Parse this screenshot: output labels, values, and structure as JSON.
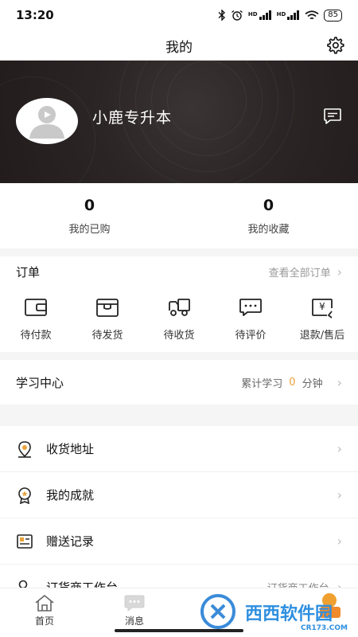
{
  "status": {
    "time": "13:20",
    "battery": "85",
    "hd1": "HD",
    "hd2": "HD"
  },
  "header": {
    "title": "我的"
  },
  "profile": {
    "name": "小鹿专升本"
  },
  "stats": [
    {
      "value": "0",
      "label": "我的已购"
    },
    {
      "value": "0",
      "label": "我的收藏"
    }
  ],
  "orders": {
    "title": "订单",
    "view_all": "查看全部订单",
    "items": [
      {
        "label": "待付款",
        "icon": "wallet-icon"
      },
      {
        "label": "待发货",
        "icon": "box-icon"
      },
      {
        "label": "待收货",
        "icon": "truck-icon"
      },
      {
        "label": "待评价",
        "icon": "comment-icon"
      },
      {
        "label": "退款/售后",
        "icon": "refund-icon"
      }
    ]
  },
  "study": {
    "title": "学习中心",
    "prefix": "累计学习",
    "minutes": "0",
    "unit": "分钟"
  },
  "menu": [
    {
      "label": "收货地址",
      "icon": "location-icon",
      "right": ""
    },
    {
      "label": "我的成就",
      "icon": "medal-icon",
      "right": ""
    },
    {
      "label": "赠送记录",
      "icon": "gift-record-icon",
      "right": ""
    },
    {
      "label": "订货商工作台",
      "icon": "user-workbench-icon",
      "right": "订货商工作台"
    }
  ],
  "tabs": [
    {
      "label": "首页",
      "icon": "home-icon"
    },
    {
      "label": "消息",
      "icon": "message-icon"
    }
  ],
  "watermark": {
    "text": "西西软件园",
    "site": "CR173.COM"
  }
}
